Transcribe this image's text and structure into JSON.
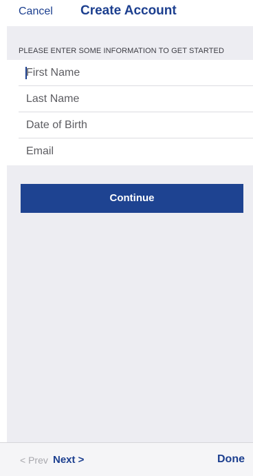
{
  "nav": {
    "cancel_label": "Cancel",
    "title": "Create Account"
  },
  "form": {
    "section_header": "PLEASE ENTER SOME INFORMATION TO GET STARTED",
    "fields": [
      {
        "placeholder": "First Name",
        "value": ""
      },
      {
        "placeholder": "Last Name",
        "value": ""
      },
      {
        "placeholder": "Date of Birth",
        "value": ""
      },
      {
        "placeholder": "Email",
        "value": ""
      }
    ]
  },
  "actions": {
    "continue_label": "Continue"
  },
  "keyboard_toolbar": {
    "prev_label": "< Prev",
    "next_label": "Next >",
    "done_label": "Done"
  },
  "colors": {
    "accent": "#1c3f8f",
    "button_background": "#1e4391",
    "grouped_background": "#ededf2"
  }
}
